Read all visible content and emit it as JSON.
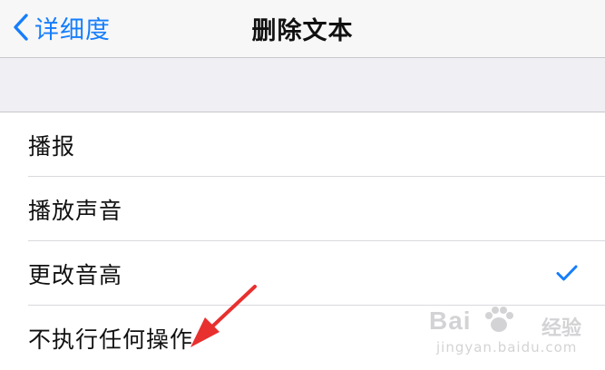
{
  "navbar": {
    "back_label": "详细度",
    "back_icon": "chevron-left-icon",
    "title": "删除文本"
  },
  "options": [
    {
      "label": "播报",
      "selected": false
    },
    {
      "label": "播放声音",
      "selected": false
    },
    {
      "label": "更改音高",
      "selected": true
    },
    {
      "label": "不执行任何操作",
      "selected": false
    }
  ],
  "colors": {
    "accent": "#157efb",
    "annotation_arrow": "#e8302f"
  },
  "watermark": {
    "brand": "Bai",
    "product": "经验",
    "url": "jingyan.baidu.com"
  }
}
